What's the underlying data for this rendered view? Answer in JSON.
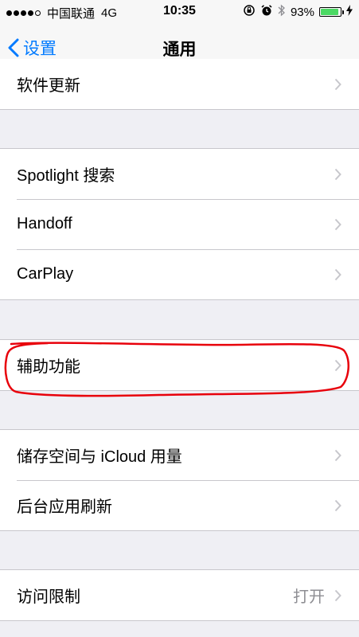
{
  "status_bar": {
    "carrier": "中国联通",
    "network": "4G",
    "time": "10:35",
    "battery_percent": "93%",
    "battery_level": 0.93
  },
  "nav": {
    "back_label": "设置",
    "title": "通用"
  },
  "groups": [
    {
      "items": [
        {
          "label": "软件更新"
        }
      ]
    },
    {
      "items": [
        {
          "label": "Spotlight 搜索"
        },
        {
          "label": "Handoff"
        },
        {
          "label": "CarPlay"
        }
      ]
    },
    {
      "items": [
        {
          "label": "辅助功能"
        }
      ]
    },
    {
      "items": [
        {
          "label": "储存空间与 iCloud 用量"
        },
        {
          "label": "后台应用刷新"
        }
      ]
    },
    {
      "items": [
        {
          "label": "访问限制",
          "value": "打开"
        }
      ]
    }
  ],
  "colors": {
    "accent": "#007aff",
    "annotation": "#e8000b",
    "battery": "#4cd964"
  }
}
